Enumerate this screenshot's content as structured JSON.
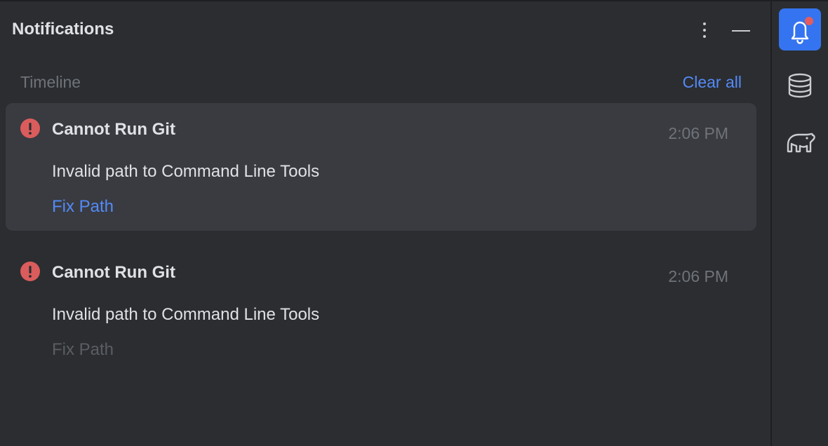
{
  "panel": {
    "title": "Notifications",
    "section_label": "Timeline",
    "clear_all_label": "Clear all"
  },
  "notifications": [
    {
      "title": "Cannot Run Git",
      "time": "2:06 PM",
      "body": "Invalid path to Command Line Tools",
      "action": "Fix Path",
      "highlighted": true
    },
    {
      "title": "Cannot Run Git",
      "time": "2:06 PM",
      "body": "Invalid path to Command Line Tools",
      "action": "Fix Path",
      "highlighted": false
    }
  ],
  "toolbar": {
    "items": [
      {
        "icon": "bell-icon",
        "selected": true,
        "has_badge": true
      },
      {
        "icon": "database-icon",
        "selected": false
      },
      {
        "icon": "gradle-elephant-icon",
        "selected": false
      }
    ]
  },
  "colors": {
    "background": "#2b2d30",
    "card_highlight": "#393b40",
    "accent": "#548af7",
    "selected_button": "#3574f0",
    "error": "#db5c5c",
    "badge": "#e55c5c"
  }
}
